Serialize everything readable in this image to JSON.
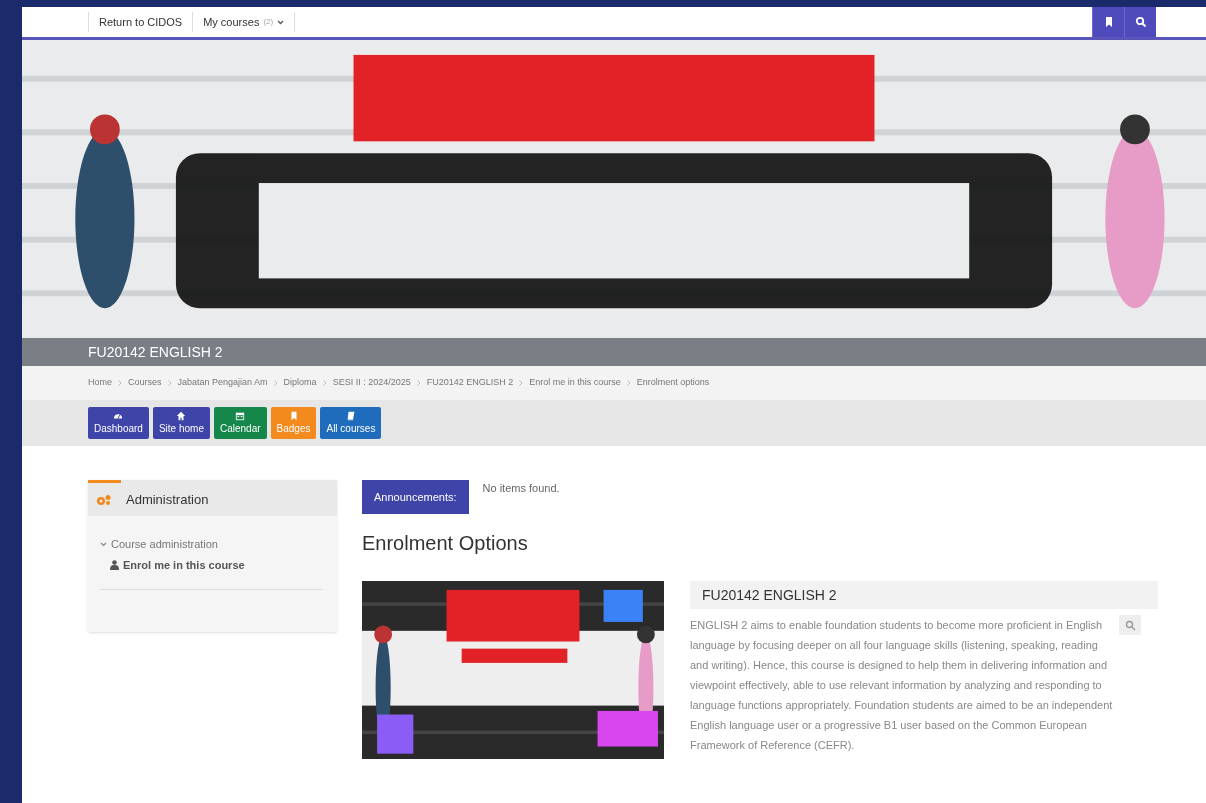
{
  "navbar": {
    "links": [
      {
        "label": "Return to CIDOS",
        "kind": "link"
      },
      {
        "label": "My courses",
        "kind": "dropdown",
        "count": "(2)"
      }
    ],
    "actions": [
      {
        "kind": "bookmark"
      },
      {
        "kind": "search"
      }
    ]
  },
  "course_title": "FU20142 ENGLISH 2",
  "breadcrumb": [
    "Home",
    "Courses",
    "Jabatan Pengajian Am",
    "Diploma",
    "SESI II : 2024/2025",
    "FU20142 ENGLISH 2",
    "Enrol me in this course",
    "Enrolment options"
  ],
  "quick_buttons": [
    {
      "label": "Dashboard",
      "kind": "dashboard",
      "color": "#3f44a8"
    },
    {
      "label": "Site home",
      "kind": "home",
      "color": "#3f44a8"
    },
    {
      "label": "Calendar",
      "kind": "calendar",
      "color": "#16874a"
    },
    {
      "label": "Badges",
      "kind": "badge",
      "color": "#f28a1e"
    },
    {
      "label": "All courses",
      "kind": "book",
      "color": "#1f6cbc"
    }
  ],
  "administration": {
    "title": "Administration",
    "section": {
      "label": "Course administration",
      "expanded": true,
      "items": [
        "Enrol me in this course"
      ]
    }
  },
  "announcements": {
    "label": "Announcements:",
    "message": "No items found."
  },
  "heading": "Enrolment Options",
  "course": {
    "name": "FU20142 ENGLISH 2",
    "summary": "ENGLISH 2 aims to enable foundation students to become more proficient in English language by focusing deeper on all four language skills (listening, speaking, reading and writing). Hence, this course is designed to help them in delivering information and viewpoint effectively, able to use relevant information by analyzing and responding to language functions appropriately. Foundation students are aimed to be an independent English language user or a progressive B1 user based on the Common European Framework of Reference (CEFR)."
  }
}
